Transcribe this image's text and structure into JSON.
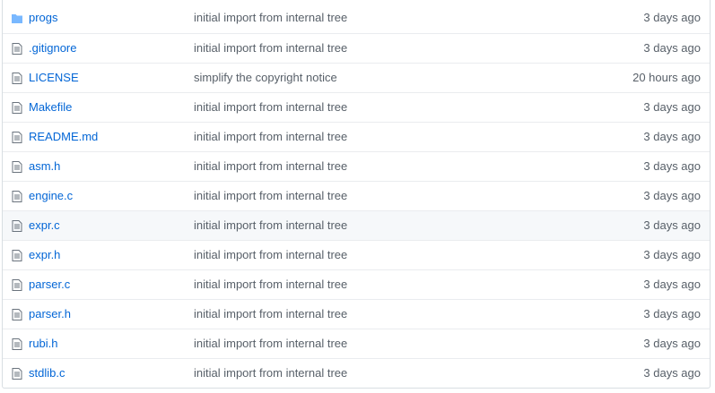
{
  "files": [
    {
      "name": "progs",
      "type": "folder",
      "icon": "folder-icon",
      "message": "initial import from internal tree",
      "age": "3 days ago"
    },
    {
      "name": ".gitignore",
      "type": "file",
      "icon": "file-icon",
      "message": "initial import from internal tree",
      "age": "3 days ago"
    },
    {
      "name": "LICENSE",
      "type": "file",
      "icon": "file-icon",
      "message": "simplify the copyright notice",
      "age": "20 hours ago"
    },
    {
      "name": "Makefile",
      "type": "file",
      "icon": "file-icon",
      "message": "initial import from internal tree",
      "age": "3 days ago"
    },
    {
      "name": "README.md",
      "type": "file",
      "icon": "file-icon",
      "message": "initial import from internal tree",
      "age": "3 days ago"
    },
    {
      "name": "asm.h",
      "type": "file",
      "icon": "file-icon",
      "message": "initial import from internal tree",
      "age": "3 days ago"
    },
    {
      "name": "engine.c",
      "type": "file",
      "icon": "file-icon",
      "message": "initial import from internal tree",
      "age": "3 days ago"
    },
    {
      "name": "expr.c",
      "type": "file",
      "icon": "file-icon",
      "message": "initial import from internal tree",
      "age": "3 days ago"
    },
    {
      "name": "expr.h",
      "type": "file",
      "icon": "file-icon",
      "message": "initial import from internal tree",
      "age": "3 days ago"
    },
    {
      "name": "parser.c",
      "type": "file",
      "icon": "file-icon",
      "message": "initial import from internal tree",
      "age": "3 days ago"
    },
    {
      "name": "parser.h",
      "type": "file",
      "icon": "file-icon",
      "message": "initial import from internal tree",
      "age": "3 days ago"
    },
    {
      "name": "rubi.h",
      "type": "file",
      "icon": "file-icon",
      "message": "initial import from internal tree",
      "age": "3 days ago"
    },
    {
      "name": "stdlib.c",
      "type": "file",
      "icon": "file-icon",
      "message": "initial import from internal tree",
      "age": "3 days ago"
    }
  ],
  "colors": {
    "link": "#0366d6",
    "muted": "#586069",
    "folder": "#79b8ff",
    "border": "#eaecef",
    "hover_row": "#f6f8fa"
  }
}
